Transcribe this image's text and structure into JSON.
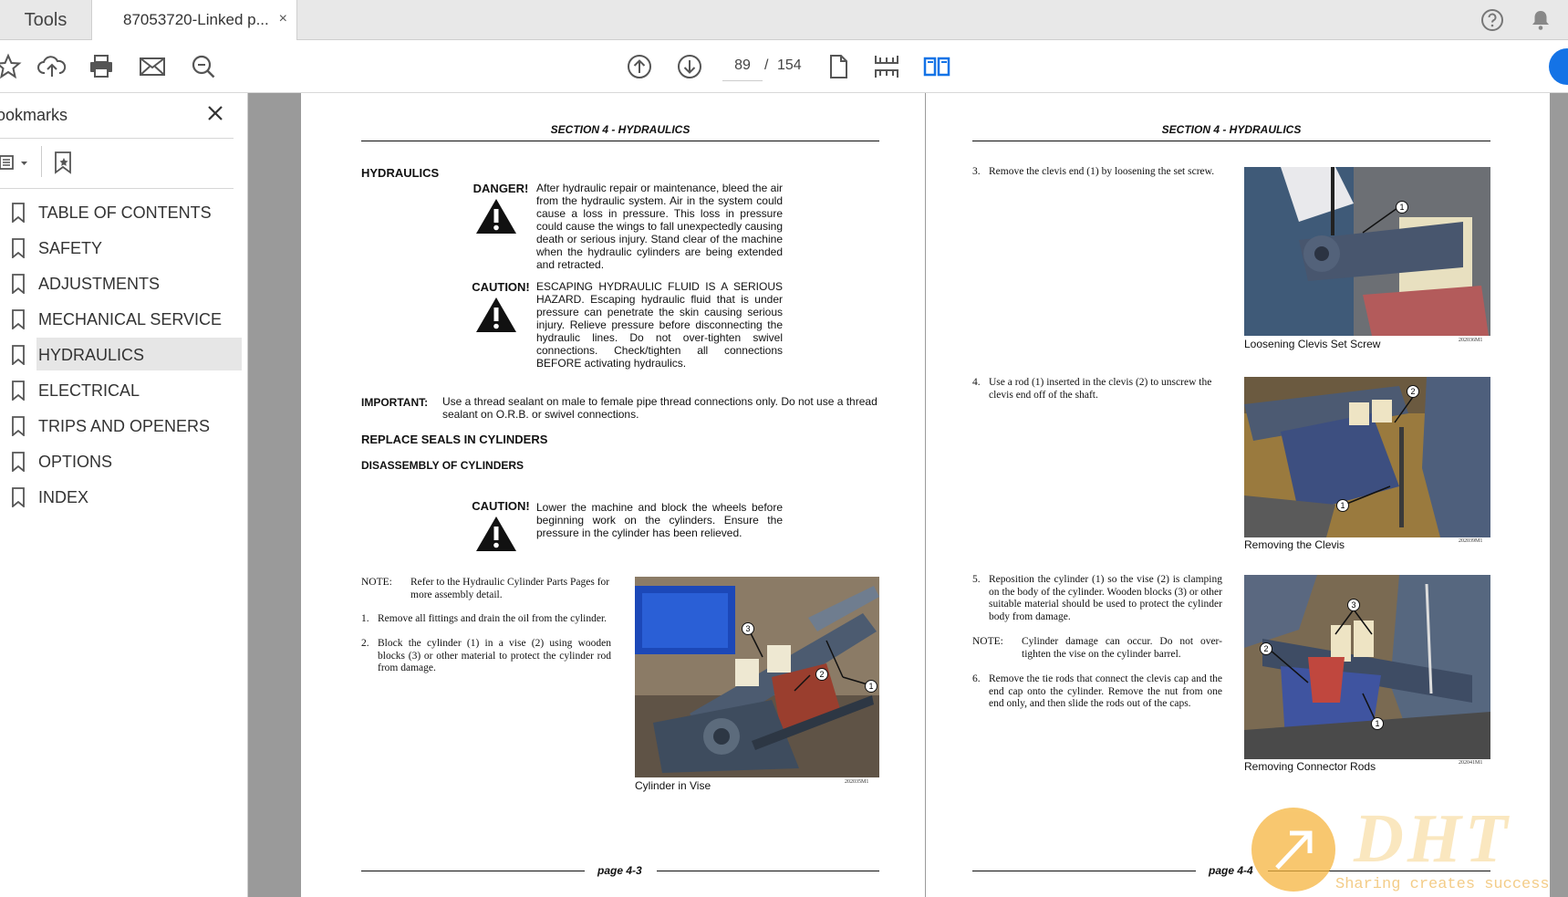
{
  "tabs": {
    "tools": "Tools",
    "document": "87053720-Linked p...",
    "close": "×"
  },
  "toolbar": {
    "current_page": "89",
    "separator": "/",
    "total_pages": "154"
  },
  "sidebar": {
    "title": "ookmarks",
    "items": [
      {
        "label": "TABLE OF CONTENTS"
      },
      {
        "label": "SAFETY"
      },
      {
        "label": "ADJUSTMENTS"
      },
      {
        "label": "MECHANICAL SERVICE"
      },
      {
        "label": "HYDRAULICS"
      },
      {
        "label": "ELECTRICAL"
      },
      {
        "label": "TRIPS AND OPENERS"
      },
      {
        "label": "OPTIONS"
      },
      {
        "label": "INDEX"
      }
    ]
  },
  "left_page": {
    "header": "SECTION 4 - HYDRAULICS",
    "heading": "HYDRAULICS",
    "danger_label": "DANGER!",
    "danger_text": "After hydraulic repair or maintenance, bleed the air from the hydraulic system.  Air in the system could cause a loss in pressure.  This loss in pressure could cause the wings to fall unexpectedly causing death or serious injury. Stand clear of the machine when the hydraulic cylinders are being extended and retracted.",
    "caution1_label": "CAUTION!",
    "caution1_text": "ESCAPING HYDRAULIC FLUID IS A SERIOUS HAZARD.  Escaping hydraulic fluid that is under pressure can penetrate the skin causing serious injury.  Relieve pressure before disconnecting the hydraulic lines.  Do not over-tighten swivel connections.  Check/tighten all connections BEFORE activating hydraulics.",
    "important_label": "IMPORTANT:",
    "important_text": "Use a thread sealant on male to female pipe thread connections only.  Do not use a thread sealant on O.R.B. or swivel connections.",
    "subheading1": "REPLACE SEALS IN CYLINDERS",
    "subheading2": "DISASSEMBLY OF CYLINDERS",
    "caution2_label": "CAUTION!",
    "caution2_text": "Lower the machine and block the wheels before beginning work on the cylinders.  Ensure the pressure in the cylinder has been relieved.",
    "note_label": "NOTE:",
    "note_text": "Refer to the Hydraulic Cylinder Parts Pages for more assembly detail.",
    "step1_num": "1.",
    "step1_text": "Remove all fittings and drain the oil from the cylinder.",
    "step2_num": "2.",
    "step2_text": "Block the cylinder (1) in a vise (2) using wooden blocks (3) or other material to protect the cylinder rod from damage.",
    "photo_caption": "Cylinder in Vise",
    "photo_code": "202035M1",
    "photo_callouts": [
      "1",
      "2",
      "3"
    ],
    "footer": "page 4-3"
  },
  "right_page": {
    "header": "SECTION 4 - HYDRAULICS",
    "step3_num": "3.",
    "step3_text": "Remove the clevis end (1) by loosening the set screw.",
    "photo1_caption": "Loosening Clevis Set Screw",
    "photo1_code": "202036M1",
    "photo1_callouts": [
      "1"
    ],
    "step4_num": "4.",
    "step4_text": "Use a rod (1) inserted in the clevis (2) to unscrew the clevis end off of the shaft.",
    "photo2_caption": "Removing the Clevis",
    "photo2_code": "202039M1",
    "photo2_callouts": [
      "1",
      "2"
    ],
    "step5_num": "5.",
    "step5_text": "Reposition the cylinder (1) so the vise (2) is clamping on the body of the cylinder.  Wooden blocks (3) or other suitable material should be used to protect the cylinder body from damage.",
    "note_label": "NOTE:",
    "note_text": "Cylinder damage can occur.  Do not over-tighten the vise on the cylinder barrel.",
    "step6_num": "6.",
    "step6_text": "Remove the tie rods that connect the clevis cap and the end cap onto the cylinder.  Remove the nut from one end only, and then slide the rods out of the caps.",
    "photo3_caption": "Removing Connector Rods",
    "photo3_code": "202041M1",
    "photo3_callouts": [
      "1",
      "2",
      "3"
    ],
    "footer": "page 4-4"
  },
  "watermark": {
    "big": "DHT",
    "small": "Sharing creates success"
  },
  "colors": {
    "accent_blue": "#1473e6",
    "toolbar_icon": "#555555",
    "watermark_orange": "#f6b53f"
  }
}
